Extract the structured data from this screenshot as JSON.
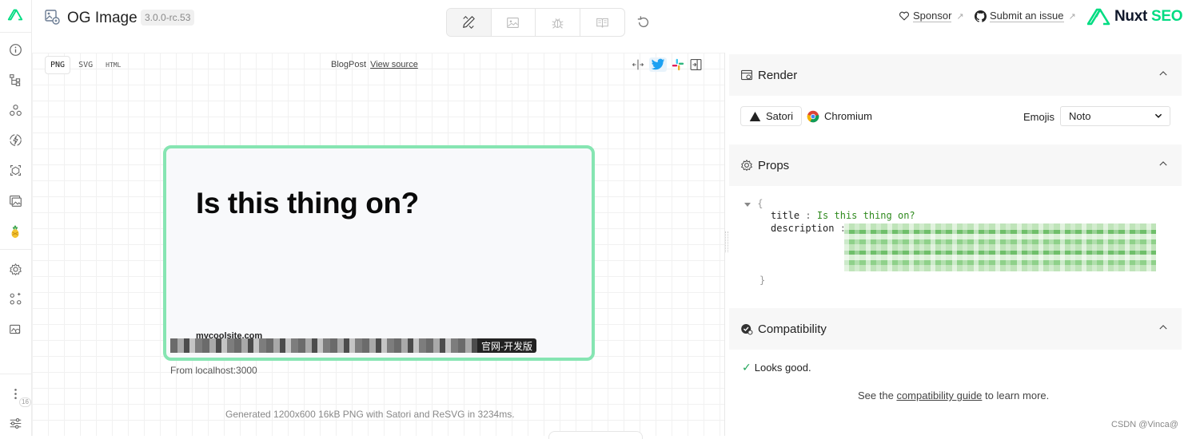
{
  "header": {
    "title": "OG Image",
    "version": "3.0.0-rc.53",
    "sponsor": "Sponsor",
    "submit_issue": "Submit an issue",
    "brand_primary": "Nuxt",
    "brand_secondary": "SEO"
  },
  "tabs": [
    {
      "icon": "design-icon",
      "active": true
    },
    {
      "icon": "image-icon",
      "active": false
    },
    {
      "icon": "debug-icon",
      "active": false
    },
    {
      "icon": "docs-icon",
      "active": false
    }
  ],
  "rail": {
    "badge": "16",
    "icons": [
      "info-icon",
      "components-icon",
      "modules-icon",
      "lightning-icon",
      "assets-icon",
      "image-icon",
      "pineapple-icon",
      "settings-icon",
      "hooks-icon",
      "extension-icon",
      "more-icon",
      "sliders-icon"
    ]
  },
  "preview": {
    "formats": [
      "PNG",
      "SVG",
      "HTML"
    ],
    "active_format": "PNG",
    "component_name": "BlogPost",
    "view_source": "View source",
    "og_title": "Is this thing on?",
    "og_site": "mycoolsite.com",
    "og_badge": "官网-开发版",
    "from": "From localhost:3000",
    "generated": "Generated 1200x600 16kB PNG with Satori and ReSVG in 3234ms."
  },
  "render": {
    "title": "Render",
    "renderers": [
      "Satori",
      "Chromium"
    ],
    "active_renderer": "Satori",
    "emojis_label": "Emojis",
    "emojis_value": "Noto"
  },
  "props": {
    "title": "Props",
    "open_brace": "{",
    "close_brace": "}",
    "key_title": "title",
    "value_title": "Is this thing on?",
    "key_description": "description",
    "colon": ":"
  },
  "compatibility": {
    "title": "Compatibility",
    "status": "Looks good.",
    "see_prefix": "See the",
    "guide_link": "compatibility guide",
    "see_suffix": "to learn more."
  },
  "watermark": "CSDN @Vinca@",
  "colors": {
    "accent": "#00dc82",
    "frame": "#86e5b2",
    "json_value": "#2f8a1e",
    "twitter": "#1da1f2"
  }
}
